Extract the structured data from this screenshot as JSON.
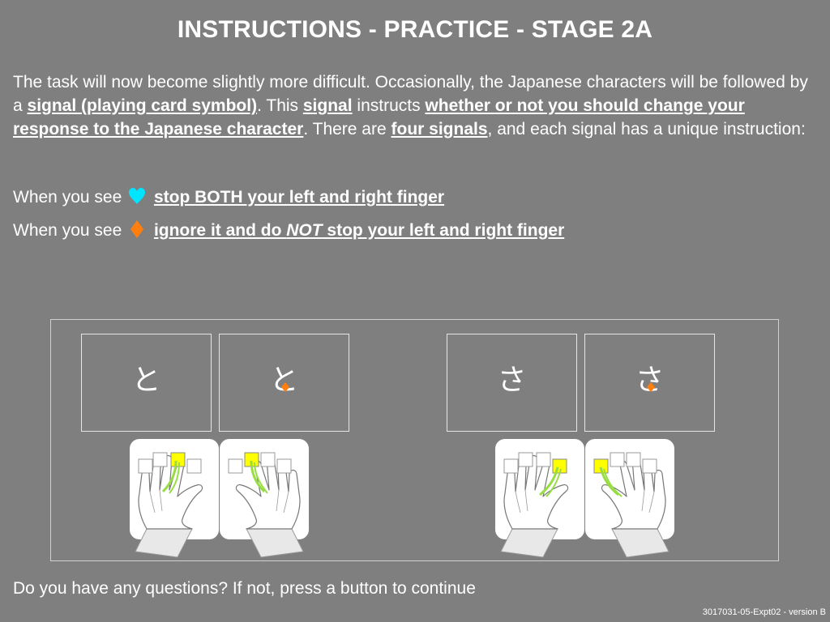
{
  "title": "INSTRUCTIONS - PRACTICE - STAGE 2A",
  "intro": {
    "t1": "The task will now become slightly more difficult. Occasionally, the Japanese characters will be followed by a ",
    "b1": "signal (playing card symbol)",
    "t2": ". This ",
    "b2": "signal",
    "t3": " instructs ",
    "b3": "whether or not you should change your response to the Japanese character",
    "t4": ". There are ",
    "b4": "four signals",
    "t5": ", and each signal has a unique instruction:"
  },
  "instructions": [
    {
      "prefix": "When you see",
      "suit": "heart-icon",
      "suit_color": "#00e5ff",
      "text": "stop BOTH your left and right finger"
    },
    {
      "prefix": "When you see",
      "suit": "diamond-icon",
      "suit_color": "#ff7f0e",
      "text_a": "ignore it and do ",
      "text_em": "NOT",
      "text_b": " stop your left and right finger"
    }
  ],
  "example": {
    "panels": [
      {
        "char": "と",
        "signal": null
      },
      {
        "char": "と",
        "signal": "diamond-icon"
      },
      {
        "char": "さ",
        "signal": null
      },
      {
        "char": "さ",
        "signal": "diamond-icon"
      }
    ],
    "highlight_color": "#ffff00",
    "finger_color": "#99dd44"
  },
  "footer": "Do you have any questions? If not, press a button to continue",
  "version": "3017031-05-Expt02 - version B",
  "colors": {
    "background": "#7f7f7f",
    "text": "#ffffff"
  }
}
